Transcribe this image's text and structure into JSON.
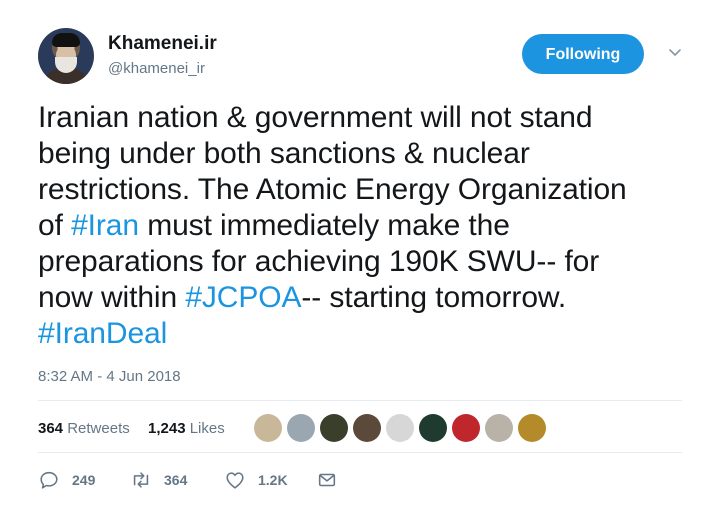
{
  "author": {
    "name": "Khamenei.ir",
    "handle": "@khamenei_ir",
    "follow_label": "Following"
  },
  "tweet": {
    "segments": [
      {
        "text": "Iranian nation & government will not stand\nbeing under both sanctions & nuclear\nrestrictions. The Atomic Energy Organization\nof ",
        "tag": false
      },
      {
        "text": "#Iran",
        "tag": true
      },
      {
        "text": " must immediately make the\npreparations for achieving 190K SWU-- for\nnow within ",
        "tag": false
      },
      {
        "text": "#JCPOA",
        "tag": true
      },
      {
        "text": "-- starting tomorrow.\n",
        "tag": false
      },
      {
        "text": "#IranDeal",
        "tag": true
      }
    ],
    "timestamp": "8:32 AM - 4 Jun 2018"
  },
  "stats": {
    "retweets_count": "364",
    "retweets_label": "Retweets",
    "likes_count": "1,243",
    "likes_label": "Likes"
  },
  "likers": [
    {
      "color": "#c9b79a"
    },
    {
      "color": "#9aa7b1"
    },
    {
      "color": "#3a3f2c"
    },
    {
      "color": "#5b4a3a"
    },
    {
      "color": "#d7d7d7"
    },
    {
      "color": "#1f3b30"
    },
    {
      "color": "#c0272d"
    },
    {
      "color": "#b8b2a8"
    },
    {
      "color": "#b58a2a"
    }
  ],
  "actions": {
    "reply_count": "249",
    "retweet_count": "364",
    "like_count": "1.2K"
  },
  "colors": {
    "accent": "#1b95e0",
    "text": "#14171a",
    "muted": "#657786"
  }
}
